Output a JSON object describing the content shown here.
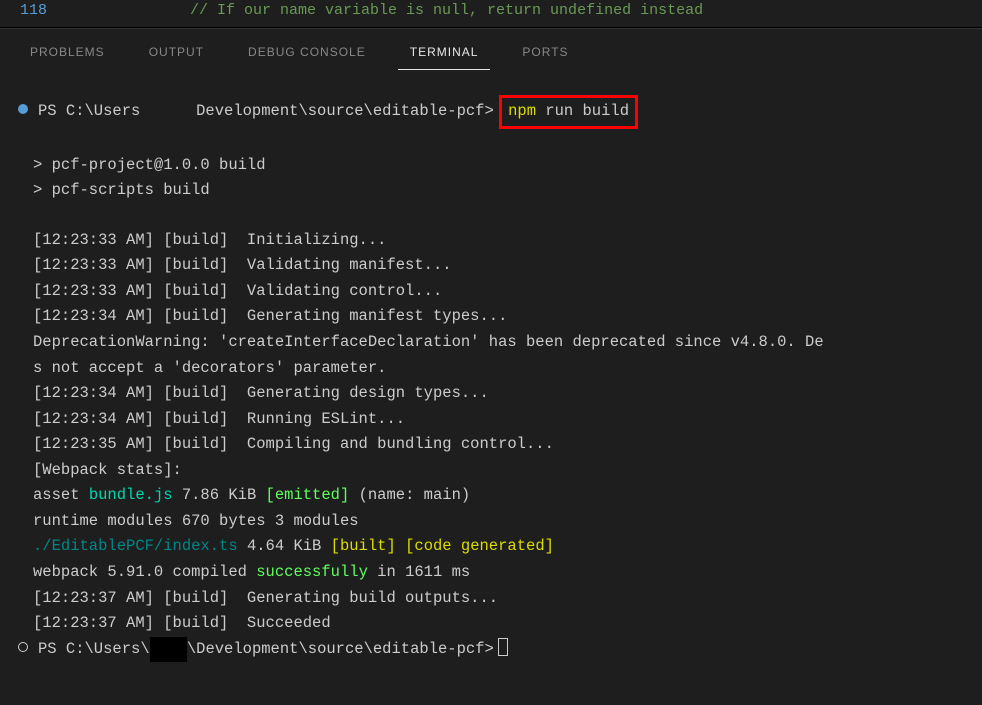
{
  "editor": {
    "line_number": "118",
    "comment": "// If our name variable is null, return undefined instead"
  },
  "tabs": {
    "problems": "PROBLEMS",
    "output": "OUTPUT",
    "debug_console": "DEBUG CONSOLE",
    "terminal": "TERMINAL",
    "ports": "PORTS"
  },
  "terminal": {
    "prompt1_prefix": "PS C:\\Users      Development\\source\\editable-pcf>",
    "cmd_npm": "npm",
    "cmd_run_build": " run build",
    "script_line1": "> pcf-project@1.0.0 build",
    "script_line2": "> pcf-scripts build",
    "log1": "[12:23:33 AM] [build]  Initializing...",
    "log2": "[12:23:33 AM] [build]  Validating manifest...",
    "log3": "[12:23:33 AM] [build]  Validating control...",
    "log4": "[12:23:34 AM] [build]  Generating manifest types...",
    "dep1": "DeprecationWarning: 'createInterfaceDeclaration' has been deprecated since v4.8.0. De",
    "dep2": "s not accept a 'decorators' parameter.",
    "log5": "[12:23:34 AM] [build]  Generating design types...",
    "log6": "[12:23:34 AM] [build]  Running ESLint...",
    "log7": "[12:23:35 AM] [build]  Compiling and bundling control...",
    "webpack_stats": "[Webpack stats]:",
    "asset_pre": "asset ",
    "asset_bundle": "bundle.js",
    "asset_size": " 7.86 KiB ",
    "asset_emitted": "[emitted]",
    "asset_post": " (name: main)",
    "runtime": "runtime modules 670 bytes 3 modules",
    "index_path": "./EditablePCF/index.ts",
    "index_size": " 4.64 KiB ",
    "index_built": "[built]",
    "index_space": " ",
    "index_codegen": "[code generated]",
    "compile_pre": "webpack 5.91.0 compiled ",
    "compile_success": "successfully",
    "compile_post": " in 1611 ms",
    "log8": "[12:23:37 AM] [build]  Generating build outputs...",
    "log9": "[12:23:37 AM] [build]  Succeeded",
    "prompt2_a": "PS C:\\Users\\",
    "prompt2_redact": "    ",
    "prompt2_b": "\\Development\\source\\editable-pcf>"
  }
}
